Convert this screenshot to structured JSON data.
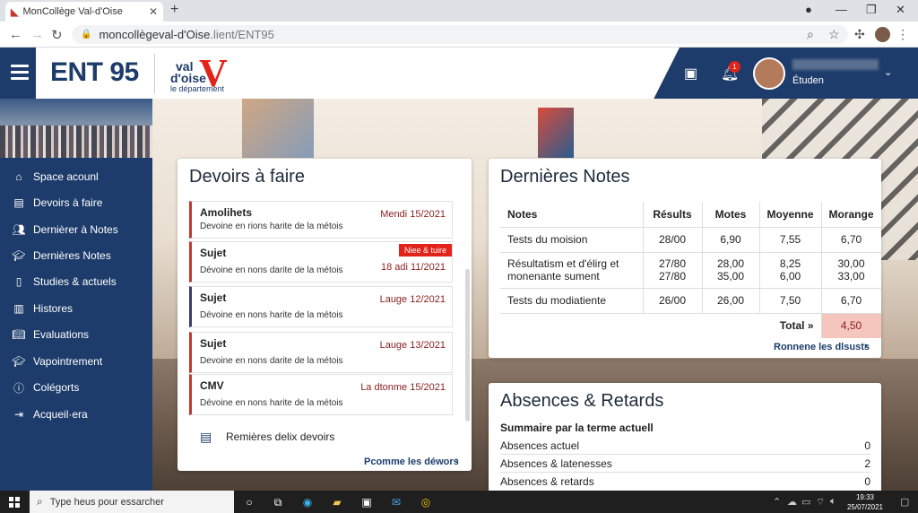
{
  "browser": {
    "tab_title": "MonCollège Val-d'Oise",
    "url_host": "moncollègeval-d'Oise",
    "url_path": ".lient/ENT95"
  },
  "header": {
    "brand": "ENT 95",
    "logo": {
      "line1": "val",
      "line2": "d'oise",
      "line3": "le département"
    },
    "notification_count": "1",
    "user_role": "Étuden"
  },
  "sidebar": {
    "items": [
      {
        "label": "Space acounl",
        "icon": "home-icon"
      },
      {
        "label": "Devoirs à faire",
        "icon": "clipboard-icon"
      },
      {
        "label": "Dernièrer à Notes",
        "icon": "users-icon"
      },
      {
        "label": "Dernières Notes",
        "icon": "graduation-cap-icon"
      },
      {
        "label": "Studies & actuels",
        "icon": "document-icon"
      },
      {
        "label": "Histores",
        "icon": "clipboard-list-icon"
      },
      {
        "label": "Evaluations",
        "icon": "book-icon"
      },
      {
        "label": "Vapointrement",
        "icon": "graduation-cap-icon"
      },
      {
        "label": "Colégorts",
        "icon": "info-icon"
      },
      {
        "label": "Acqueil·era",
        "icon": "logout-icon"
      }
    ]
  },
  "homework": {
    "title": "Devoirs à faire",
    "items": [
      {
        "subject": "Amolihets",
        "desc": "Devoine en rions harite de la métois",
        "date": "Mendi 15/2021",
        "badge": ""
      },
      {
        "subject": "Sujet",
        "desc": "Dévoine en nons darite de la métois",
        "date": "18 adi 11/2021",
        "badge": "Niee & tuire"
      },
      {
        "subject": "Sujet",
        "desc": "Dévoine en nons harite de la métois",
        "date": "Lauge 12/2021",
        "badge": ""
      },
      {
        "subject": "Sujet",
        "desc": "Devoine en nons darite de la métois",
        "date": "Lauge 13/2021",
        "badge": ""
      },
      {
        "subject": "CMV",
        "desc": "Dévoine en nons harite de la métois",
        "date": "La dtonme 15/2021",
        "badge": ""
      }
    ],
    "footer_label": "Remières delix devoirs",
    "more_link": "Pcomme les déwors"
  },
  "grades": {
    "title": "Dernières Notes",
    "columns": [
      "Notes",
      "Résults",
      "Motes",
      "Moyenne",
      "Morange"
    ],
    "rows": [
      {
        "name": "Tests du moision",
        "c1": "28/00",
        "c2": "6,90",
        "c3": "7,55",
        "c4": "6,70"
      },
      {
        "name": "Résultatism et d'élirg et monenante sument",
        "c1": "27/80\n27/80",
        "c2": "28,00\n35,00",
        "c3": "8,25\n6,00",
        "c4": "30,00\n33,00"
      },
      {
        "name": "Tests du modiatiente",
        "c1": "26/00",
        "c2": "26,00",
        "c3": "7,50",
        "c4": "6,70"
      }
    ],
    "total_label": "Total »",
    "total_value": "4,50",
    "more_link": "Ronnene les dlsusts"
  },
  "absences": {
    "title": "Absences & Retards",
    "subtitle": "Summaire par la terme actuell",
    "rows": [
      {
        "label": "Absences actuel",
        "value": "0"
      },
      {
        "label": "Absences & latenesses",
        "value": "2"
      },
      {
        "label": "Absences & retards",
        "value": "0"
      }
    ]
  },
  "taskbar": {
    "search_placeholder": "Type heus pour essarcher",
    "time": "19:33",
    "date": "25/07/2021"
  },
  "colors": {
    "navy": "#1d3c6b",
    "accent_red": "#e2231a",
    "total_bg": "#f5c6bd"
  }
}
